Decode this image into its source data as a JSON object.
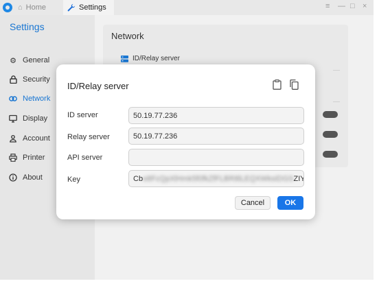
{
  "titlebar": {
    "tabs": [
      {
        "label": "Home",
        "icon": "home-icon"
      },
      {
        "label": "Settings",
        "icon": "wrench-icon"
      }
    ],
    "window_controls": [
      "≡",
      "—",
      "□",
      "×"
    ]
  },
  "sidebar": {
    "title": "Settings",
    "items": [
      {
        "label": "General",
        "icon": "gear-icon"
      },
      {
        "label": "Security",
        "icon": "lock-icon"
      },
      {
        "label": "Network",
        "icon": "link-icon",
        "active": true
      },
      {
        "label": "Display",
        "icon": "monitor-icon"
      },
      {
        "label": "Account",
        "icon": "user-icon"
      },
      {
        "label": "Printer",
        "icon": "printer-icon"
      },
      {
        "label": "About",
        "icon": "info-icon"
      }
    ]
  },
  "network": {
    "title": "Network",
    "id_relay_label": "ID/Relay server"
  },
  "dialog": {
    "title": "ID/Relay server",
    "fields": [
      {
        "label": "ID server",
        "value": "50.19.77.236"
      },
      {
        "label": "Relay server",
        "value": "50.19.77.236"
      },
      {
        "label": "API server",
        "value": ""
      },
      {
        "label": "Key",
        "value_prefix": "Cb",
        "value_suffix": "ZIY"
      }
    ],
    "cancel_label": "Cancel",
    "ok_label": "OK"
  },
  "colors": {
    "accent": "#1976d2",
    "ok_button": "#1976e8",
    "sidebar_bg": "#e6e6e6"
  }
}
